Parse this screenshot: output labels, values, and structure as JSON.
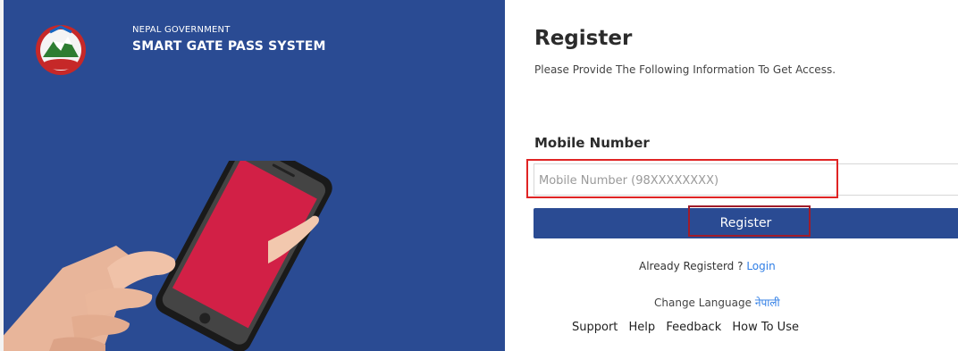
{
  "brand": {
    "org_small": "NEPAL GOVERNMENT",
    "org_big": "SMART GATE PASS SYSTEM",
    "emblem_icon": "nepal-emblem-icon"
  },
  "form": {
    "title": "Register",
    "subtitle": "Please Provide The Following Information To Get Access.",
    "mobile_label": "Mobile Number",
    "mobile_placeholder": "Mobile Number (98XXXXXXXX)",
    "mobile_value": "",
    "register_button": "Register"
  },
  "login_prompt": {
    "text": "Already Registerd ?",
    "link": "Login"
  },
  "language": {
    "text": "Change Language",
    "link": "नेपाली"
  },
  "footer_links": [
    "Support",
    "Help",
    "Feedback",
    "How To Use"
  ],
  "colors": {
    "primary": "#2a4b93",
    "link": "#2f7ee6",
    "highlight_red": "#e02424",
    "phone_screen": "#e0264c"
  }
}
